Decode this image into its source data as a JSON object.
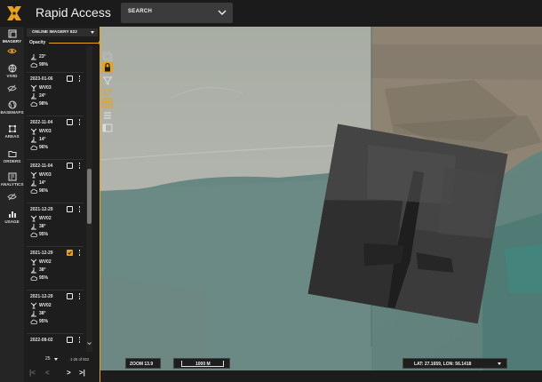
{
  "app": {
    "title": "Rapid Access",
    "search_label": "SEARCH"
  },
  "nav": {
    "items": [
      {
        "label": "IMAGERY",
        "icon": "imagery-icon"
      },
      {
        "label": "VIVID",
        "icon": "globe-icon"
      },
      {
        "label": "BASEMAPS",
        "icon": "globe-icon"
      },
      {
        "label": "AREAS",
        "icon": "area-icon"
      },
      {
        "label": "ORDERS",
        "icon": "folder-icon"
      },
      {
        "label": "ANALYTICS",
        "icon": "analytics-icon"
      },
      {
        "label": "USAGE",
        "icon": "bar-chart-icon"
      }
    ]
  },
  "panel": {
    "layer_label": "ONLINE IMAGERY 822",
    "opacity_label": "Opacity",
    "opacity": 1.0,
    "top_partial": {
      "angle": "23°",
      "cloud": "99%"
    },
    "cards": [
      {
        "date": "2023-01-06",
        "sensor": "WV03",
        "angle": "24°",
        "cloud": "98%",
        "checked": false
      },
      {
        "date": "2022-11-04",
        "sensor": "WV03",
        "angle": "14°",
        "cloud": "96%",
        "checked": false
      },
      {
        "date": "2022-11-04",
        "sensor": "WV03",
        "angle": "14°",
        "cloud": "96%",
        "checked": false
      },
      {
        "date": "2021-12-29",
        "sensor": "WV02",
        "angle": "38°",
        "cloud": "95%",
        "checked": false
      },
      {
        "date": "2021-12-29",
        "sensor": "WV02",
        "angle": "38°",
        "cloud": "95%",
        "checked": true
      },
      {
        "date": "2021-12-29",
        "sensor": "WV02",
        "angle": "38°",
        "cloud": "95%",
        "checked": false
      },
      {
        "date": "2022-08-02",
        "sensor": "",
        "angle": "",
        "cloud": "",
        "checked": false
      }
    ],
    "pager": {
      "page_size": "25",
      "range": "1-25 of 822",
      "first": "|<",
      "prev": "<",
      "next": ">",
      "last": ">|"
    }
  },
  "hud": {
    "zoom": "ZOOM 13.9",
    "scale": "1000 M",
    "coords": "LAT: 27.1659, LON: 56.1418"
  },
  "colors": {
    "accent": "#e8a317",
    "bar_bg": "#1b1b1b",
    "panel_bg": "#1d1d1d"
  }
}
